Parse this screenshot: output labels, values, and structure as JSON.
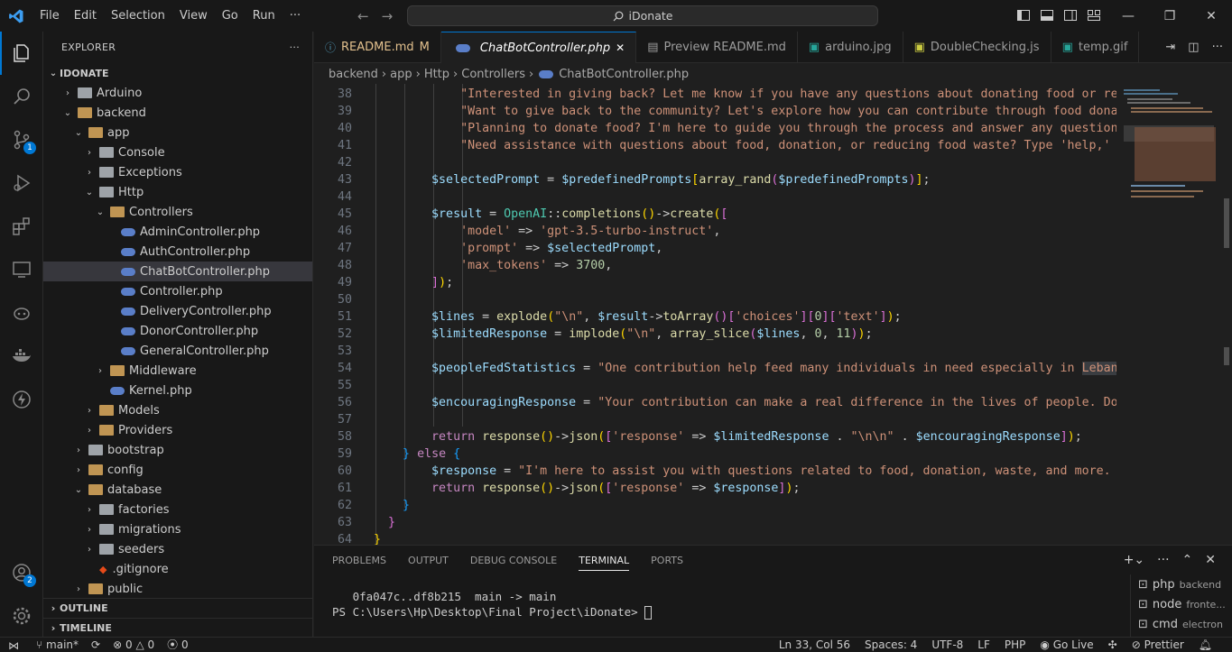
{
  "titlebar": {
    "menu": [
      "File",
      "Edit",
      "Selection",
      "View",
      "Go",
      "Run"
    ],
    "more": "···",
    "search": "iDonate"
  },
  "activity_badges": {
    "source_control": "1",
    "accounts": "2"
  },
  "sidebar": {
    "title": "EXPLORER",
    "more": "···",
    "root": "IDONATE",
    "items": [
      {
        "label": "Arduino",
        "depth": 1,
        "type": "folder",
        "open": false
      },
      {
        "label": "backend",
        "depth": 1,
        "type": "folder",
        "open": true
      },
      {
        "label": "app",
        "depth": 2,
        "type": "folder",
        "open": true
      },
      {
        "label": "Console",
        "depth": 3,
        "type": "folder",
        "open": false
      },
      {
        "label": "Exceptions",
        "depth": 3,
        "type": "folder",
        "open": false
      },
      {
        "label": "Http",
        "depth": 3,
        "type": "folder",
        "open": true
      },
      {
        "label": "Controllers",
        "depth": 4,
        "type": "folder",
        "open": true
      },
      {
        "label": "AdminController.php",
        "depth": 5,
        "type": "php"
      },
      {
        "label": "AuthController.php",
        "depth": 5,
        "type": "php"
      },
      {
        "label": "ChatBotController.php",
        "depth": 5,
        "type": "php",
        "selected": true
      },
      {
        "label": "Controller.php",
        "depth": 5,
        "type": "php"
      },
      {
        "label": "DeliveryController.php",
        "depth": 5,
        "type": "php"
      },
      {
        "label": "DonorController.php",
        "depth": 5,
        "type": "php"
      },
      {
        "label": "GeneralController.php",
        "depth": 5,
        "type": "php"
      },
      {
        "label": "Middleware",
        "depth": 4,
        "type": "folder",
        "open": false
      },
      {
        "label": "Kernel.php",
        "depth": 4,
        "type": "php"
      },
      {
        "label": "Models",
        "depth": 3,
        "type": "folder",
        "open": false
      },
      {
        "label": "Providers",
        "depth": 3,
        "type": "folder",
        "open": false
      },
      {
        "label": "bootstrap",
        "depth": 2,
        "type": "folder",
        "open": false
      },
      {
        "label": "config",
        "depth": 2,
        "type": "folder",
        "open": false
      },
      {
        "label": "database",
        "depth": 2,
        "type": "folder",
        "open": true
      },
      {
        "label": "factories",
        "depth": 3,
        "type": "folder",
        "open": false
      },
      {
        "label": "migrations",
        "depth": 3,
        "type": "folder",
        "open": false
      },
      {
        "label": "seeders",
        "depth": 3,
        "type": "folder",
        "open": false
      },
      {
        "label": ".gitignore",
        "depth": 3,
        "type": "git"
      },
      {
        "label": "public",
        "depth": 2,
        "type": "folder",
        "open": false
      }
    ],
    "outline": "OUTLINE",
    "timeline": "TIMELINE"
  },
  "tabs": [
    {
      "label": "README.md",
      "mod": "M",
      "active": false
    },
    {
      "label": "ChatBotController.php",
      "mod": "✕",
      "active": true
    },
    {
      "label": "Preview README.md",
      "mod": "",
      "active": false
    },
    {
      "label": "arduino.jpg",
      "mod": "",
      "active": false
    },
    {
      "label": "DoubleChecking.js",
      "mod": "",
      "active": false
    },
    {
      "label": "temp.gif",
      "mod": "",
      "active": false
    }
  ],
  "breadcrumb": [
    "backend",
    "app",
    "Http",
    "Controllers",
    "ChatBotController.php"
  ],
  "code_lines": [
    {
      "n": "38",
      "html": "            <span class='s'>\"Interested in giving back? Let me know if you have any questions about donating food or reducing waste.\"</span>"
    },
    {
      "n": "39",
      "html": "            <span class='s'>\"Want to give back to the community? Let's explore how you can contribute through food donations.\"</span>"
    },
    {
      "n": "40",
      "html": "            <span class='s'>\"Planning to donate food? I'm here to guide you through the process and answer any questions.\"</span>"
    },
    {
      "n": "41",
      "html": "            <span class='s'>\"Need assistance with questions about food, donation, or reducing food waste? Type 'help,' and I'll assist.\"</span>"
    },
    {
      "n": "42",
      "html": ""
    },
    {
      "n": "43",
      "html": "        <span class='v'>$selectedPrompt</span> <span class='p'>=</span> <span class='v'>$predefinedPrompts</span><span class='b1'>[</span><span class='f'>array_rand</span><span class='b2'>(</span><span class='v'>$predefinedPrompts</span><span class='b2'>)</span><span class='b1'>]</span><span class='p'>;</span>"
    },
    {
      "n": "44",
      "html": ""
    },
    {
      "n": "45",
      "html": "        <span class='v'>$result</span> <span class='p'>=</span> <span class='t'>OpenAI</span><span class='p'>::</span><span class='f'>completions</span><span class='b1'>()</span><span class='p'>-&gt;</span><span class='f'>create</span><span class='b1'>(</span><span class='b2'>[</span>"
    },
    {
      "n": "46",
      "html": "            <span class='s'>'model'</span> <span class='p'>=&gt;</span> <span class='s'>'gpt-3.5-turbo-instruct'</span><span class='p'>,</span>"
    },
    {
      "n": "47",
      "html": "            <span class='s'>'prompt'</span> <span class='p'>=&gt;</span> <span class='v'>$selectedPrompt</span><span class='p'>,</span>"
    },
    {
      "n": "48",
      "html": "            <span class='s'>'max_tokens'</span> <span class='p'>=&gt;</span> <span class='n'>3700</span><span class='p'>,</span>"
    },
    {
      "n": "49",
      "html": "        <span class='b2'>]</span><span class='b1'>)</span><span class='p'>;</span>"
    },
    {
      "n": "50",
      "html": ""
    },
    {
      "n": "51",
      "html": "        <span class='v'>$lines</span> <span class='p'>=</span> <span class='f'>explode</span><span class='b1'>(</span><span class='s'>\"\\n\"</span><span class='p'>,</span> <span class='v'>$result</span><span class='p'>-&gt;</span><span class='f'>toArray</span><span class='b2'>()</span><span class='b2'>[</span><span class='s'>'choices'</span><span class='b2'>]</span><span class='b2'>[</span><span class='n'>0</span><span class='b2'>]</span><span class='b2'>[</span><span class='s'>'text'</span><span class='b2'>]</span><span class='b1'>)</span><span class='p'>;</span>"
    },
    {
      "n": "52",
      "html": "        <span class='v'>$limitedResponse</span> <span class='p'>=</span> <span class='f'>implode</span><span class='b1'>(</span><span class='s'>\"\\n\"</span><span class='p'>,</span> <span class='f'>array_slice</span><span class='b2'>(</span><span class='v'>$lines</span><span class='p'>,</span> <span class='n'>0</span><span class='p'>,</span> <span class='n'>11</span><span class='b2'>)</span><span class='b1'>)</span><span class='p'>;</span>"
    },
    {
      "n": "53",
      "html": ""
    },
    {
      "n": "54",
      "html": "        <span class='v'>$peopleFedStatistics</span> <span class='p'>=</span> <span class='s'>\"One contribution help feed many individuals in need especially in </span><span class='s' style='background:#3a3d41'>Lebanon</span><span class='s'>\";</span>"
    },
    {
      "n": "55",
      "html": ""
    },
    {
      "n": "56",
      "html": "        <span class='v'>$encouragingResponse</span> <span class='p'>=</span> <span class='s'>\"Your contribution can make a real difference in the lives of people. Donate today!\"</span><span class='p'>;</span>"
    },
    {
      "n": "57",
      "html": ""
    },
    {
      "n": "58",
      "html": "        <span class='k'>return</span> <span class='f'>response</span><span class='b1'>()</span><span class='p'>-&gt;</span><span class='f'>json</span><span class='b1'>(</span><span class='b2'>[</span><span class='s'>'response'</span> <span class='p'>=&gt;</span> <span class='v'>$limitedResponse</span> <span class='p'>.</span> <span class='s'>\"\\n\\n\"</span> <span class='p'>.</span> <span class='v'>$encouragingResponse</span><span class='b2'>]</span><span class='b1'>)</span><span class='p'>;</span>"
    },
    {
      "n": "59",
      "html": "    <span class='b3'>}</span> <span class='k'>else</span> <span class='b3'>{</span>"
    },
    {
      "n": "60",
      "html": "        <span class='v'>$response</span> <span class='p'>=</span> <span class='s'>\"I'm here to assist you with questions related to food, donation, waste, and more. How can I help?\"</span><span class='p'>;</span>"
    },
    {
      "n": "61",
      "html": "        <span class='k'>return</span> <span class='f'>response</span><span class='b1'>()</span><span class='p'>-&gt;</span><span class='f'>json</span><span class='b1'>(</span><span class='b2'>[</span><span class='s'>'response'</span> <span class='p'>=&gt;</span> <span class='v'>$response</span><span class='b2'>]</span><span class='b1'>)</span><span class='p'>;</span>"
    },
    {
      "n": "62",
      "html": "    <span class='b3'>}</span>"
    },
    {
      "n": "63",
      "html": "  <span class='b2'>}</span>"
    },
    {
      "n": "64",
      "html": "<span class='b1'>}</span>"
    }
  ],
  "panel": {
    "tabs": [
      "PROBLEMS",
      "OUTPUT",
      "DEBUG CONSOLE",
      "TERMINAL",
      "PORTS"
    ],
    "active_tab": "TERMINAL",
    "terminal_line1": "   0fa047c..df8b215  main -> main",
    "terminal_line2": "PS C:\\Users\\Hp\\Desktop\\Final Project\\iDonate> ",
    "terminals": [
      {
        "name": "php",
        "detail": "backend"
      },
      {
        "name": "node",
        "detail": "fronte..."
      },
      {
        "name": "cmd",
        "detail": "electron"
      }
    ]
  },
  "status": {
    "branch": "main*",
    "errors": "0",
    "warnings": "0",
    "ports": "0",
    "position": "Ln 33, Col 56",
    "spaces": "Spaces: 4",
    "encoding": "UTF-8",
    "eol": "LF",
    "language": "PHP",
    "golive": "Go Live",
    "prettier": "Prettier"
  }
}
